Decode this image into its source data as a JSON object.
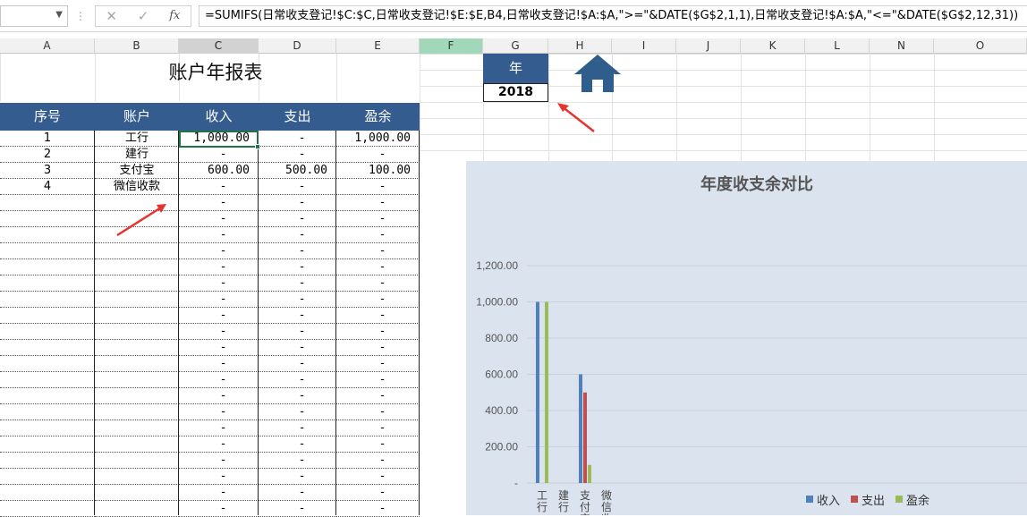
{
  "formula_bar": {
    "formula": "=SUMIFS(日常收支登记!$C:$C,日常收支登记!$E:$E,B4,日常收支登记!$A:$A,\">=\"&DATE($G$2,1,1),日常收支登记!$A:$A,\"<=\"&DATE($G$2,12,31))",
    "cancel_icon": "✕",
    "enter_icon": "✓",
    "fx_label": "fx",
    "separator": "⋮",
    "name_box_arrow": "▼"
  },
  "columns": [
    "A",
    "B",
    "C",
    "D",
    "E",
    "F",
    "G",
    "H",
    "I",
    "J",
    "K",
    "L",
    "N",
    "O"
  ],
  "sheet": {
    "title": "账户年报表",
    "year_label": "年",
    "year_value": "2018",
    "headers": [
      "序号",
      "账户",
      "收入",
      "支出",
      "盈余"
    ],
    "rows": [
      {
        "no": "1",
        "account": "工行",
        "income": "1,000.00",
        "expense": "-",
        "surplus": "1,000.00"
      },
      {
        "no": "2",
        "account": "建行",
        "income": "-",
        "expense": "-",
        "surplus": "-"
      },
      {
        "no": "3",
        "account": "支付宝",
        "income": "600.00",
        "expense": "500.00",
        "surplus": "100.00"
      },
      {
        "no": "4",
        "account": "微信收款",
        "income": "-",
        "expense": "-",
        "surplus": "-"
      }
    ],
    "empty_dash": "-"
  },
  "chart_data": {
    "type": "bar",
    "title": "年度收支余对比",
    "categories": [
      "工行",
      "建行",
      "支付宝",
      "微信收款"
    ],
    "series": [
      {
        "name": "收入",
        "values": [
          1000,
          0,
          600,
          0
        ],
        "color": "#4f81bd"
      },
      {
        "name": "支出",
        "values": [
          0,
          0,
          500,
          0
        ],
        "color": "#c0504d"
      },
      {
        "name": "盈余",
        "values": [
          1000,
          0,
          100,
          0
        ],
        "color": "#9bbb59"
      }
    ],
    "ylim": [
      0,
      1200
    ],
    "yticks": [
      "-",
      "200.00",
      "400.00",
      "600.00",
      "800.00",
      "1,000.00",
      "1,200.00"
    ],
    "grid": true,
    "legend": "bottom-right"
  },
  "colors": {
    "header_blue": "#345c8f",
    "selection_green": "#217346",
    "chart_bg": "#dbe3ef",
    "arrow_red": "#e8322d"
  }
}
